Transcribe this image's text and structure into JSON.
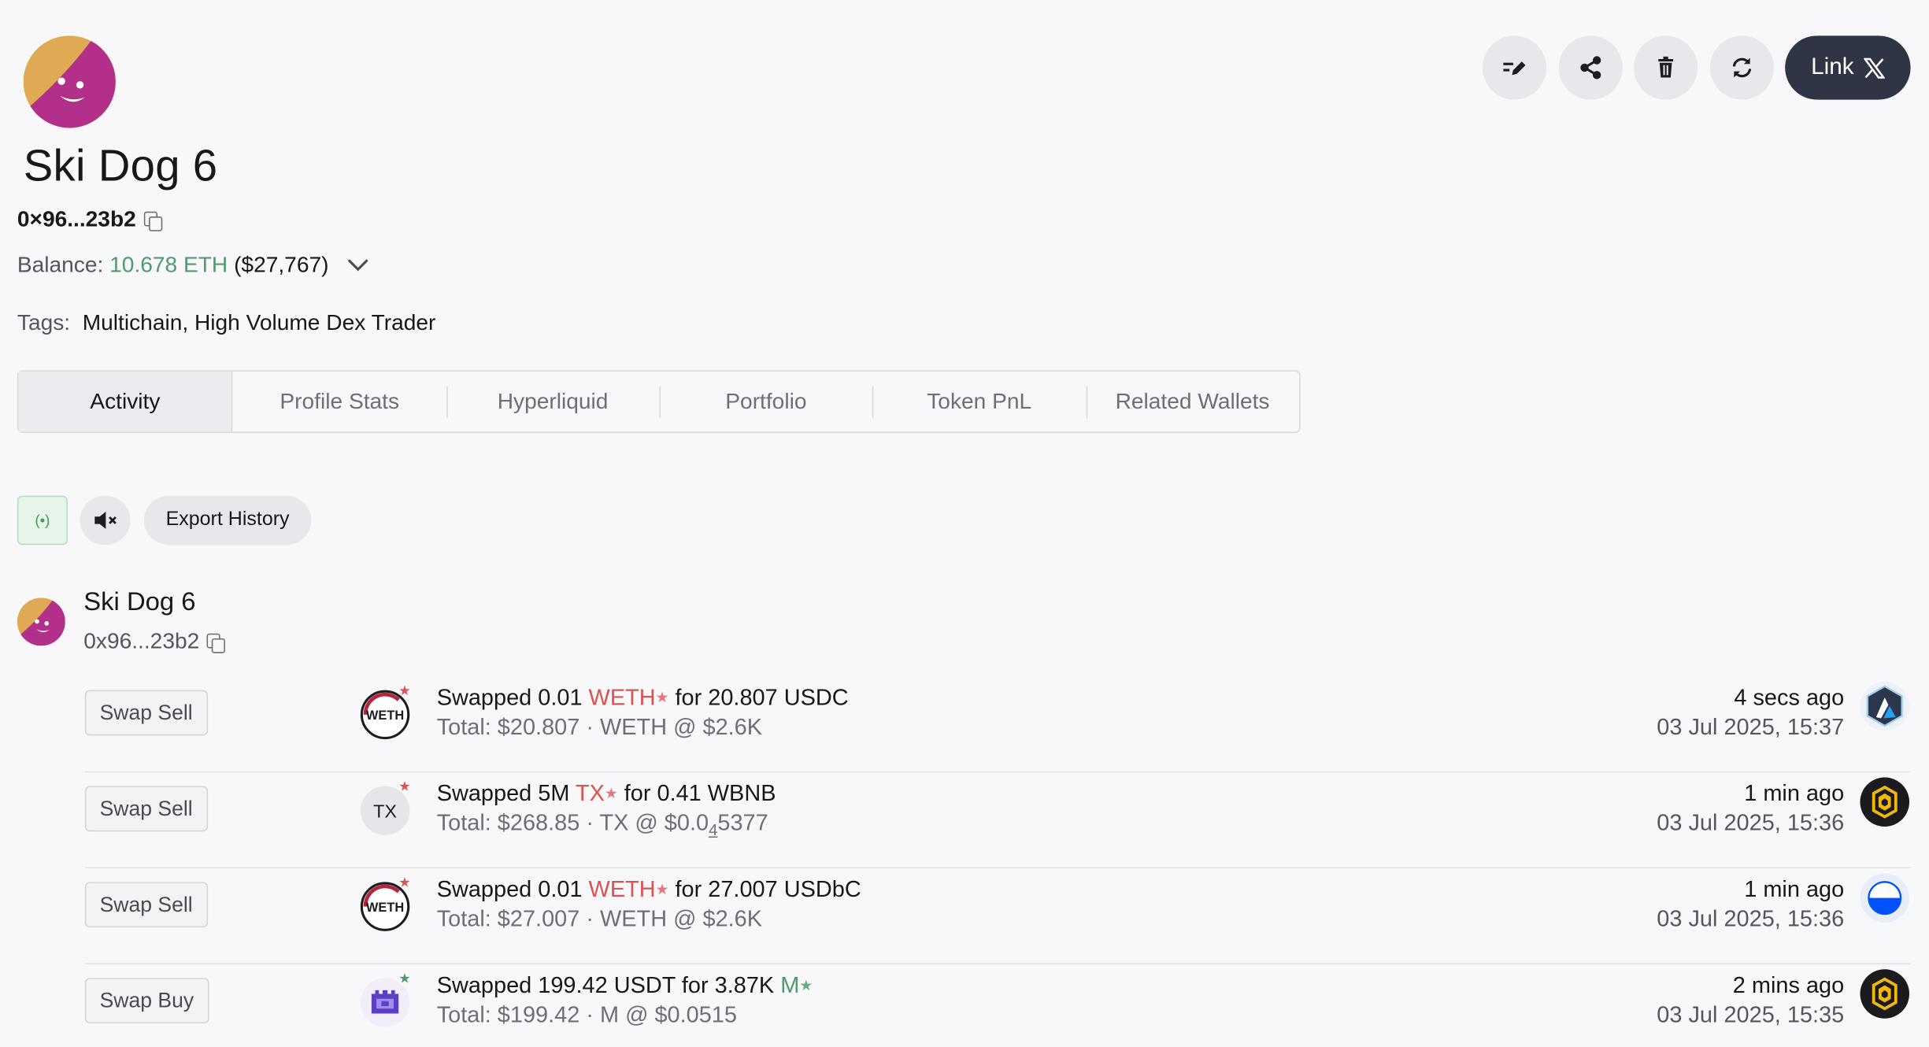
{
  "profile": {
    "name": "Ski Dog 6",
    "address": "0×96...23b2",
    "balance_label": "Balance:",
    "balance_eth": "10.678 ETH",
    "balance_usd": "($27,767)",
    "tags_label": "Tags:",
    "tags": "Multichain, High Volume Dex Trader"
  },
  "actions": {
    "link_label": "Link"
  },
  "tabs": [
    {
      "label": "Activity",
      "active": true
    },
    {
      "label": "Profile Stats",
      "active": false
    },
    {
      "label": "Hyperliquid",
      "active": false
    },
    {
      "label": "Portfolio",
      "active": false
    },
    {
      "label": "Token PnL",
      "active": false
    },
    {
      "label": "Related Wallets",
      "active": false
    }
  ],
  "toolbar": {
    "live_glyph": "(•)",
    "export_label": "Export History"
  },
  "wallet_block": {
    "name": "Ski Dog 6",
    "address": "0x96...23b2"
  },
  "activity": [
    {
      "type": "Swap Sell",
      "token_icon_text": "WETH",
      "prefix": "Swapped 0.01 ",
      "token": "WETH",
      "token_color": "red",
      "suffix": " for 20.807 USDC",
      "total": "Total: $20.807 · WETH @ $2.6K",
      "ago": "4 secs ago",
      "date": "03 Jul 2025, 15:37",
      "chain": "arbitrum"
    },
    {
      "type": "Swap Sell",
      "token_icon_text": "TX",
      "prefix": "Swapped 5M ",
      "token": "TX",
      "token_color": "red",
      "suffix": " for 0.41 WBNB",
      "total_prefix": "Total: $268.85 · TX @ $0.0",
      "total_zeros": "4",
      "total_suffix": "5377",
      "ago": "1 min ago",
      "date": "03 Jul 2025, 15:36",
      "chain": "bnb"
    },
    {
      "type": "Swap Sell",
      "token_icon_text": "WETH",
      "prefix": "Swapped 0.01 ",
      "token": "WETH",
      "token_color": "red",
      "suffix": " for 27.007 USDbC",
      "total": "Total: $27.007 · WETH @ $2.6K",
      "ago": "1 min ago",
      "date": "03 Jul 2025, 15:36",
      "chain": "base"
    },
    {
      "type": "Swap Buy",
      "token_icon_text": "",
      "prefix": "Swapped 199.42 USDT for 3.87K ",
      "token": "M",
      "token_color": "green",
      "suffix": "",
      "total": "Total: $199.42 · M @ $0.0515",
      "ago": "2 mins ago",
      "date": "03 Jul 2025, 15:35",
      "chain": "bnb"
    }
  ],
  "colors": {
    "accent_green": "#4f9a6d",
    "token_red": "#d9534f",
    "link_button_bg": "#2f3545",
    "avatar_gold": "#e0aa55",
    "avatar_magenta": "#b3308a"
  }
}
